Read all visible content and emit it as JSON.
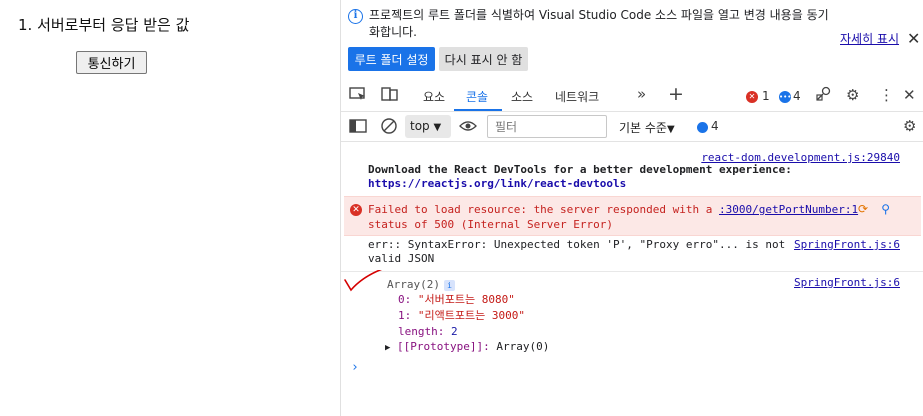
{
  "app": {
    "heading": "1. 서버로부터 응답 받은 값",
    "button_label": "통신하기"
  },
  "infobar": {
    "message": "프로젝트의 루트 폴더를 식별하여 Visual Studio Code 소스 파일을 열고 변경 내용을 동기화합니다.",
    "learn_more": "자세히 표시",
    "set_root_button": "루트 폴더 설정",
    "dont_show_button": "다시 표시 안 함"
  },
  "tabs": {
    "elements": "요소",
    "console": "콘솔",
    "sources": "소스",
    "network": "네트워크"
  },
  "status": {
    "error_count": "1",
    "message_count": "4"
  },
  "console_toolbar": {
    "context": "top",
    "filter_placeholder": "필터",
    "levels": "기본 수준",
    "issues_count": "4"
  },
  "messages": {
    "m1_source": "react-dom.development.js:29840",
    "m1_text": "Download the React DevTools for a better development experience: ",
    "m1_link": "https://reactjs.org/link/react-devtools",
    "m2_text_before": "Failed to load resource: the server responded with a ",
    "m2_link": ":3000/getPortNumber:1",
    "m2_text_after": "status of 500 (Internal Server Error)",
    "m3_text": "err:: SyntaxError: Unexpected token 'P', \"Proxy erro\"... is not valid JSON",
    "m3_source": "SpringFront.js:6",
    "m4_source": "SpringFront.js:6",
    "array_head": "Array(2)",
    "item0_key": "0:",
    "item0_val": "\"서버포트는 8080\"",
    "item1_key": "1:",
    "item1_val": "\"리액트포트는 3000\"",
    "length_key": "length:",
    "length_val": "2",
    "proto_key": "[[Prototype]]:",
    "proto_val": "Array(0)"
  },
  "colors": {
    "accent": "#1a73e8",
    "error": "#d93025",
    "error_bg": "#fce8e6",
    "annotation": "#d50000"
  }
}
